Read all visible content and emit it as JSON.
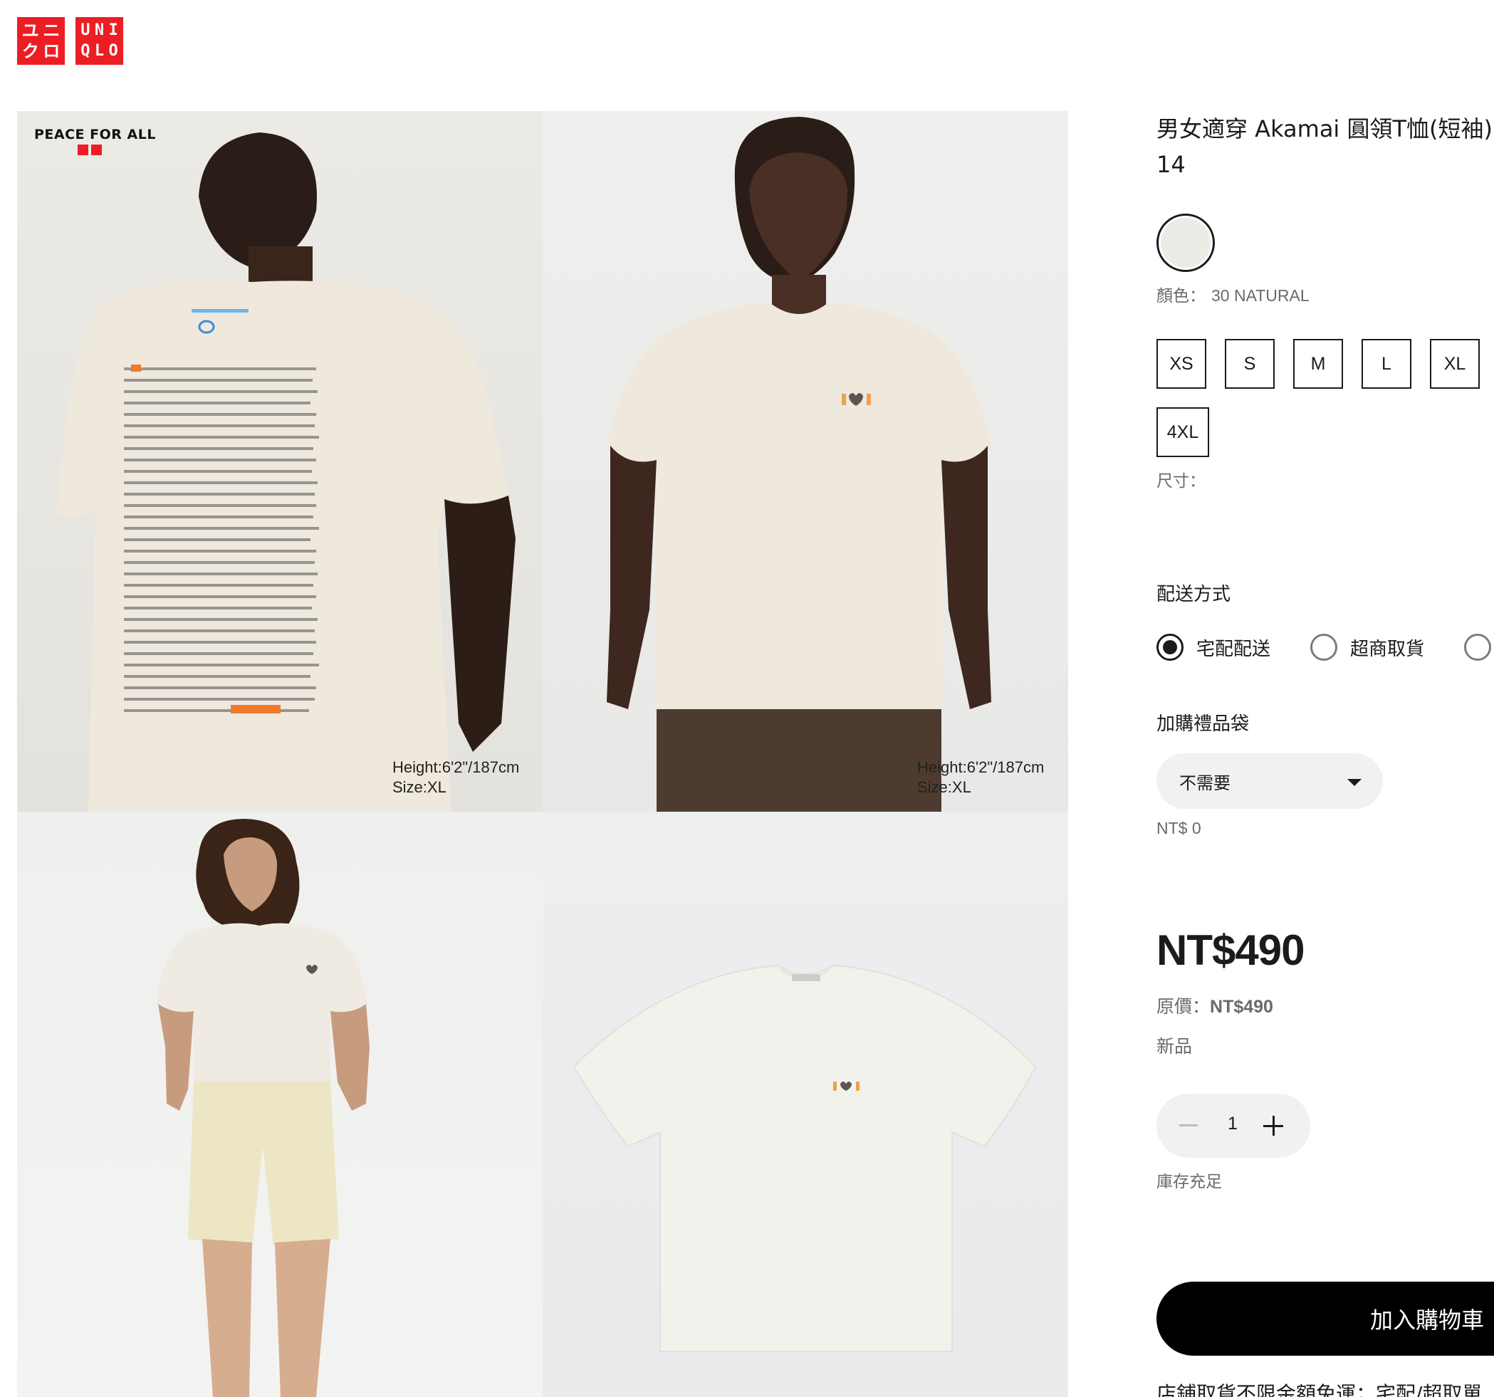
{
  "brand": {
    "logo_left": [
      "ユ",
      "ニ",
      "ク",
      "ロ"
    ],
    "logo_right": [
      "U",
      "N",
      "I",
      "Q",
      "L",
      "O"
    ],
    "accent_color": "#ed1d24"
  },
  "gallery": {
    "badge_text": "PEACE FOR ALL",
    "model_height": "Height:6'2\"/187cm",
    "model_size": "Size:XL"
  },
  "product": {
    "title_line1": "男女適穿 Akamai 圓領T恤(短袖)",
    "title_line2": "14",
    "color_label": "顏色：",
    "color_value": "30 NATURAL",
    "swatch_color": "#ecebe6",
    "sizes": [
      "XS",
      "S",
      "M",
      "L",
      "XL",
      "4XL"
    ],
    "size_label": "尺寸：",
    "delivery_heading": "配送方式",
    "delivery_options": [
      "宅配配送",
      "超商取貨"
    ],
    "delivery_selected": "宅配配送",
    "giftbag_heading": "加購禮品袋",
    "giftbag_selected": "不需要",
    "giftbag_price": "NT$ 0",
    "price": "NT$490",
    "original_label": "原價：",
    "original_price": "NT$490",
    "new_tag": "新品",
    "quantity": "1",
    "stock_status": "庫存充足",
    "add_to_cart": "加入購物車",
    "bottom_note": "店鋪取貨不限金額免運；宅配/超取單"
  }
}
